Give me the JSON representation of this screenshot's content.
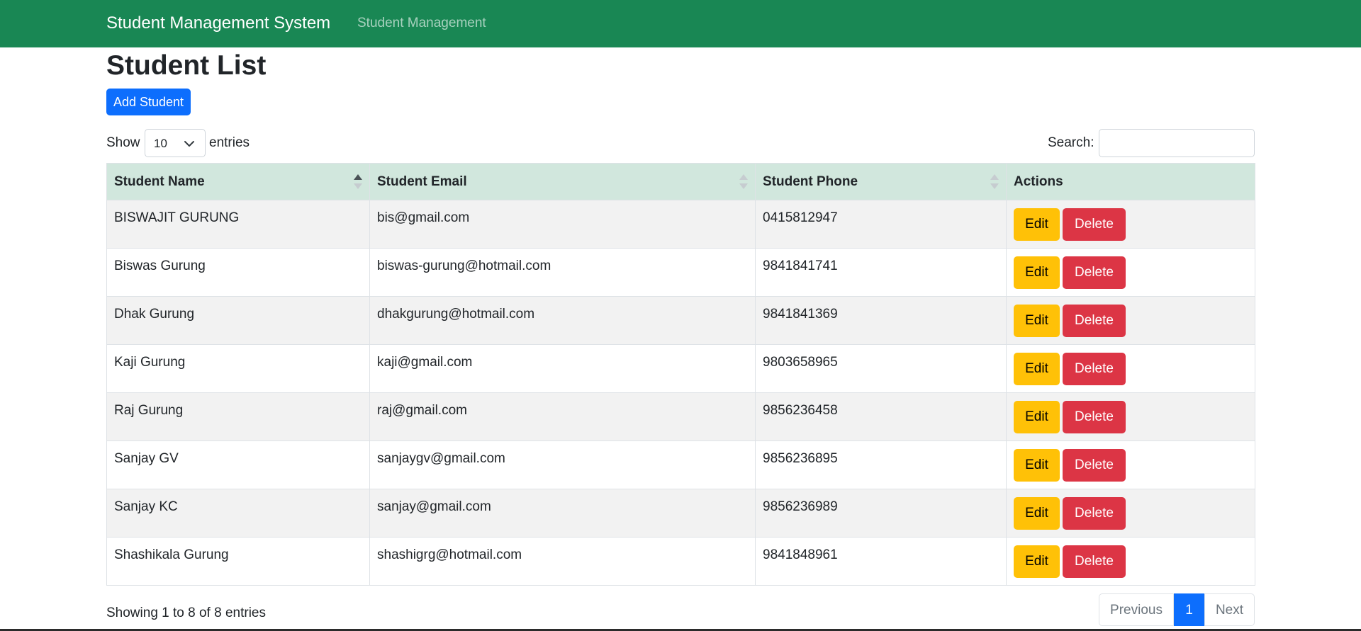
{
  "navbar": {
    "brand": "Student Management System",
    "link": "Student Management",
    "color": "#198754"
  },
  "page": {
    "title": "Student List",
    "add_button": "Add Student"
  },
  "controls": {
    "show_label": "Show",
    "entries_value": "10",
    "entries_label": "entries",
    "search_label": "Search:",
    "search_value": ""
  },
  "table": {
    "columns": [
      "Student Name",
      "Student Email",
      "Student Phone",
      "Actions"
    ],
    "rows": [
      {
        "name": "BISWAJIT GURUNG",
        "email": "bis@gmail.com",
        "phone": "0415812947"
      },
      {
        "name": "Biswas Gurung",
        "email": "biswas-gurung@hotmail.com",
        "phone": "9841841741"
      },
      {
        "name": "Dhak Gurung",
        "email": "dhakgurung@hotmail.com",
        "phone": "9841841369"
      },
      {
        "name": "Kaji Gurung",
        "email": "kaji@gmail.com",
        "phone": "9803658965"
      },
      {
        "name": "Raj Gurung",
        "email": "raj@gmail.com",
        "phone": "9856236458"
      },
      {
        "name": "Sanjay GV",
        "email": "sanjaygv@gmail.com",
        "phone": "9856236895"
      },
      {
        "name": "Sanjay KC",
        "email": "sanjay@gmail.com",
        "phone": "9856236989"
      },
      {
        "name": "Shashikala Gurung",
        "email": "shashigrg@hotmail.com",
        "phone": "9841848961"
      }
    ],
    "edit_label": "Edit",
    "delete_label": "Delete"
  },
  "footer": {
    "info": "Showing 1 to 8 of 8 entries",
    "previous": "Previous",
    "current_page": "1",
    "next": "Next"
  }
}
